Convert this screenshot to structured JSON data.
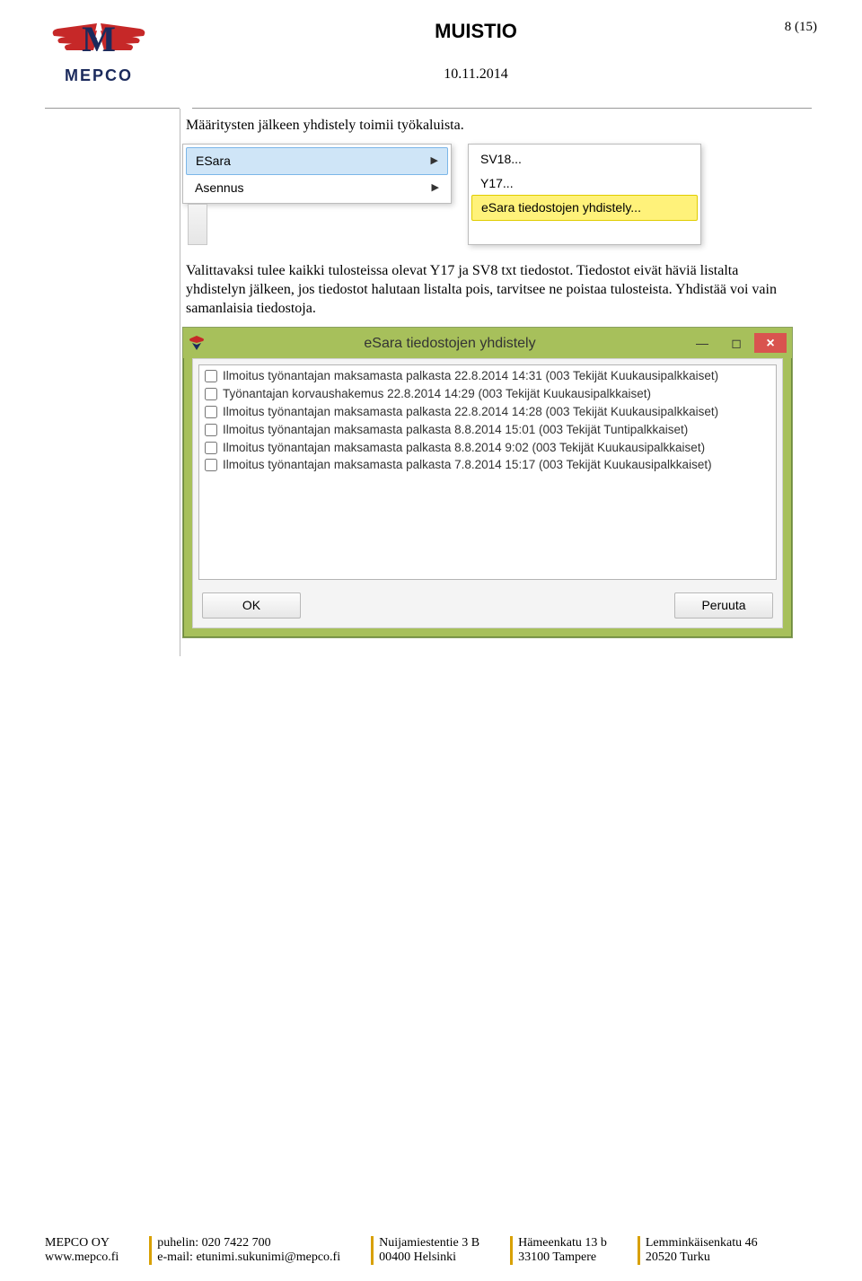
{
  "header": {
    "logo_text": "MEPCO",
    "doc_title": "MUISTIO",
    "date": "10.11.2014",
    "page_label": "8 (15)"
  },
  "body": {
    "para1": "Määritysten jälkeen yhdistely toimii työkaluista.",
    "menu_left": {
      "items": [
        "ESara",
        "Asennus"
      ]
    },
    "menu_right": {
      "items": [
        "SV18...",
        "Y17...",
        "eSara tiedostojen yhdistely..."
      ]
    },
    "para2": "Valittavaksi tulee kaikki tulosteissa olevat Y17 ja SV8 txt tiedostot. Tiedostot eivät häviä listalta yhdistelyn jälkeen, jos tiedostot halutaan listalta pois, tarvitsee ne poistaa tulosteista. Yhdistää voi vain samanlaisia tiedostoja.",
    "dialog": {
      "title": "eSara tiedostojen yhdistely",
      "ok_label": "OK",
      "cancel_label": "Peruuta",
      "rows": [
        "Ilmoitus työnantajan maksamasta palkasta 22.8.2014 14:31 (003 Tekijät Kuukausipalkkaiset)",
        "Työnantajan korvaushakemus 22.8.2014 14:29 (003 Tekijät Kuukausipalkkaiset)",
        "Ilmoitus työnantajan maksamasta palkasta 22.8.2014 14:28 (003 Tekijät Kuukausipalkkaiset)",
        "Ilmoitus työnantajan maksamasta palkasta 8.8.2014 15:01 (003 Tekijät Tuntipalkkaiset)",
        "Ilmoitus työnantajan maksamasta palkasta 8.8.2014 9:02 (003 Tekijät Kuukausipalkkaiset)",
        "Ilmoitus työnantajan maksamasta palkasta 7.8.2014 15:17 (003 Tekijät Kuukausipalkkaiset)"
      ]
    }
  },
  "footer": {
    "c1": {
      "l1": "MEPCO OY",
      "l2": "www.mepco.fi"
    },
    "c2": {
      "l1": "puhelin: 020 7422 700",
      "l2": "e-mail: etunimi.sukunimi@mepco.fi"
    },
    "c3": {
      "l1": "Nuijamiestentie 3 B",
      "l2": "00400 Helsinki"
    },
    "c4": {
      "l1": "Hämeenkatu 13 b",
      "l2": "33100 Tampere"
    },
    "c5": {
      "l1": "Lemminkäisenkatu 46",
      "l2": "20520 Turku"
    }
  }
}
